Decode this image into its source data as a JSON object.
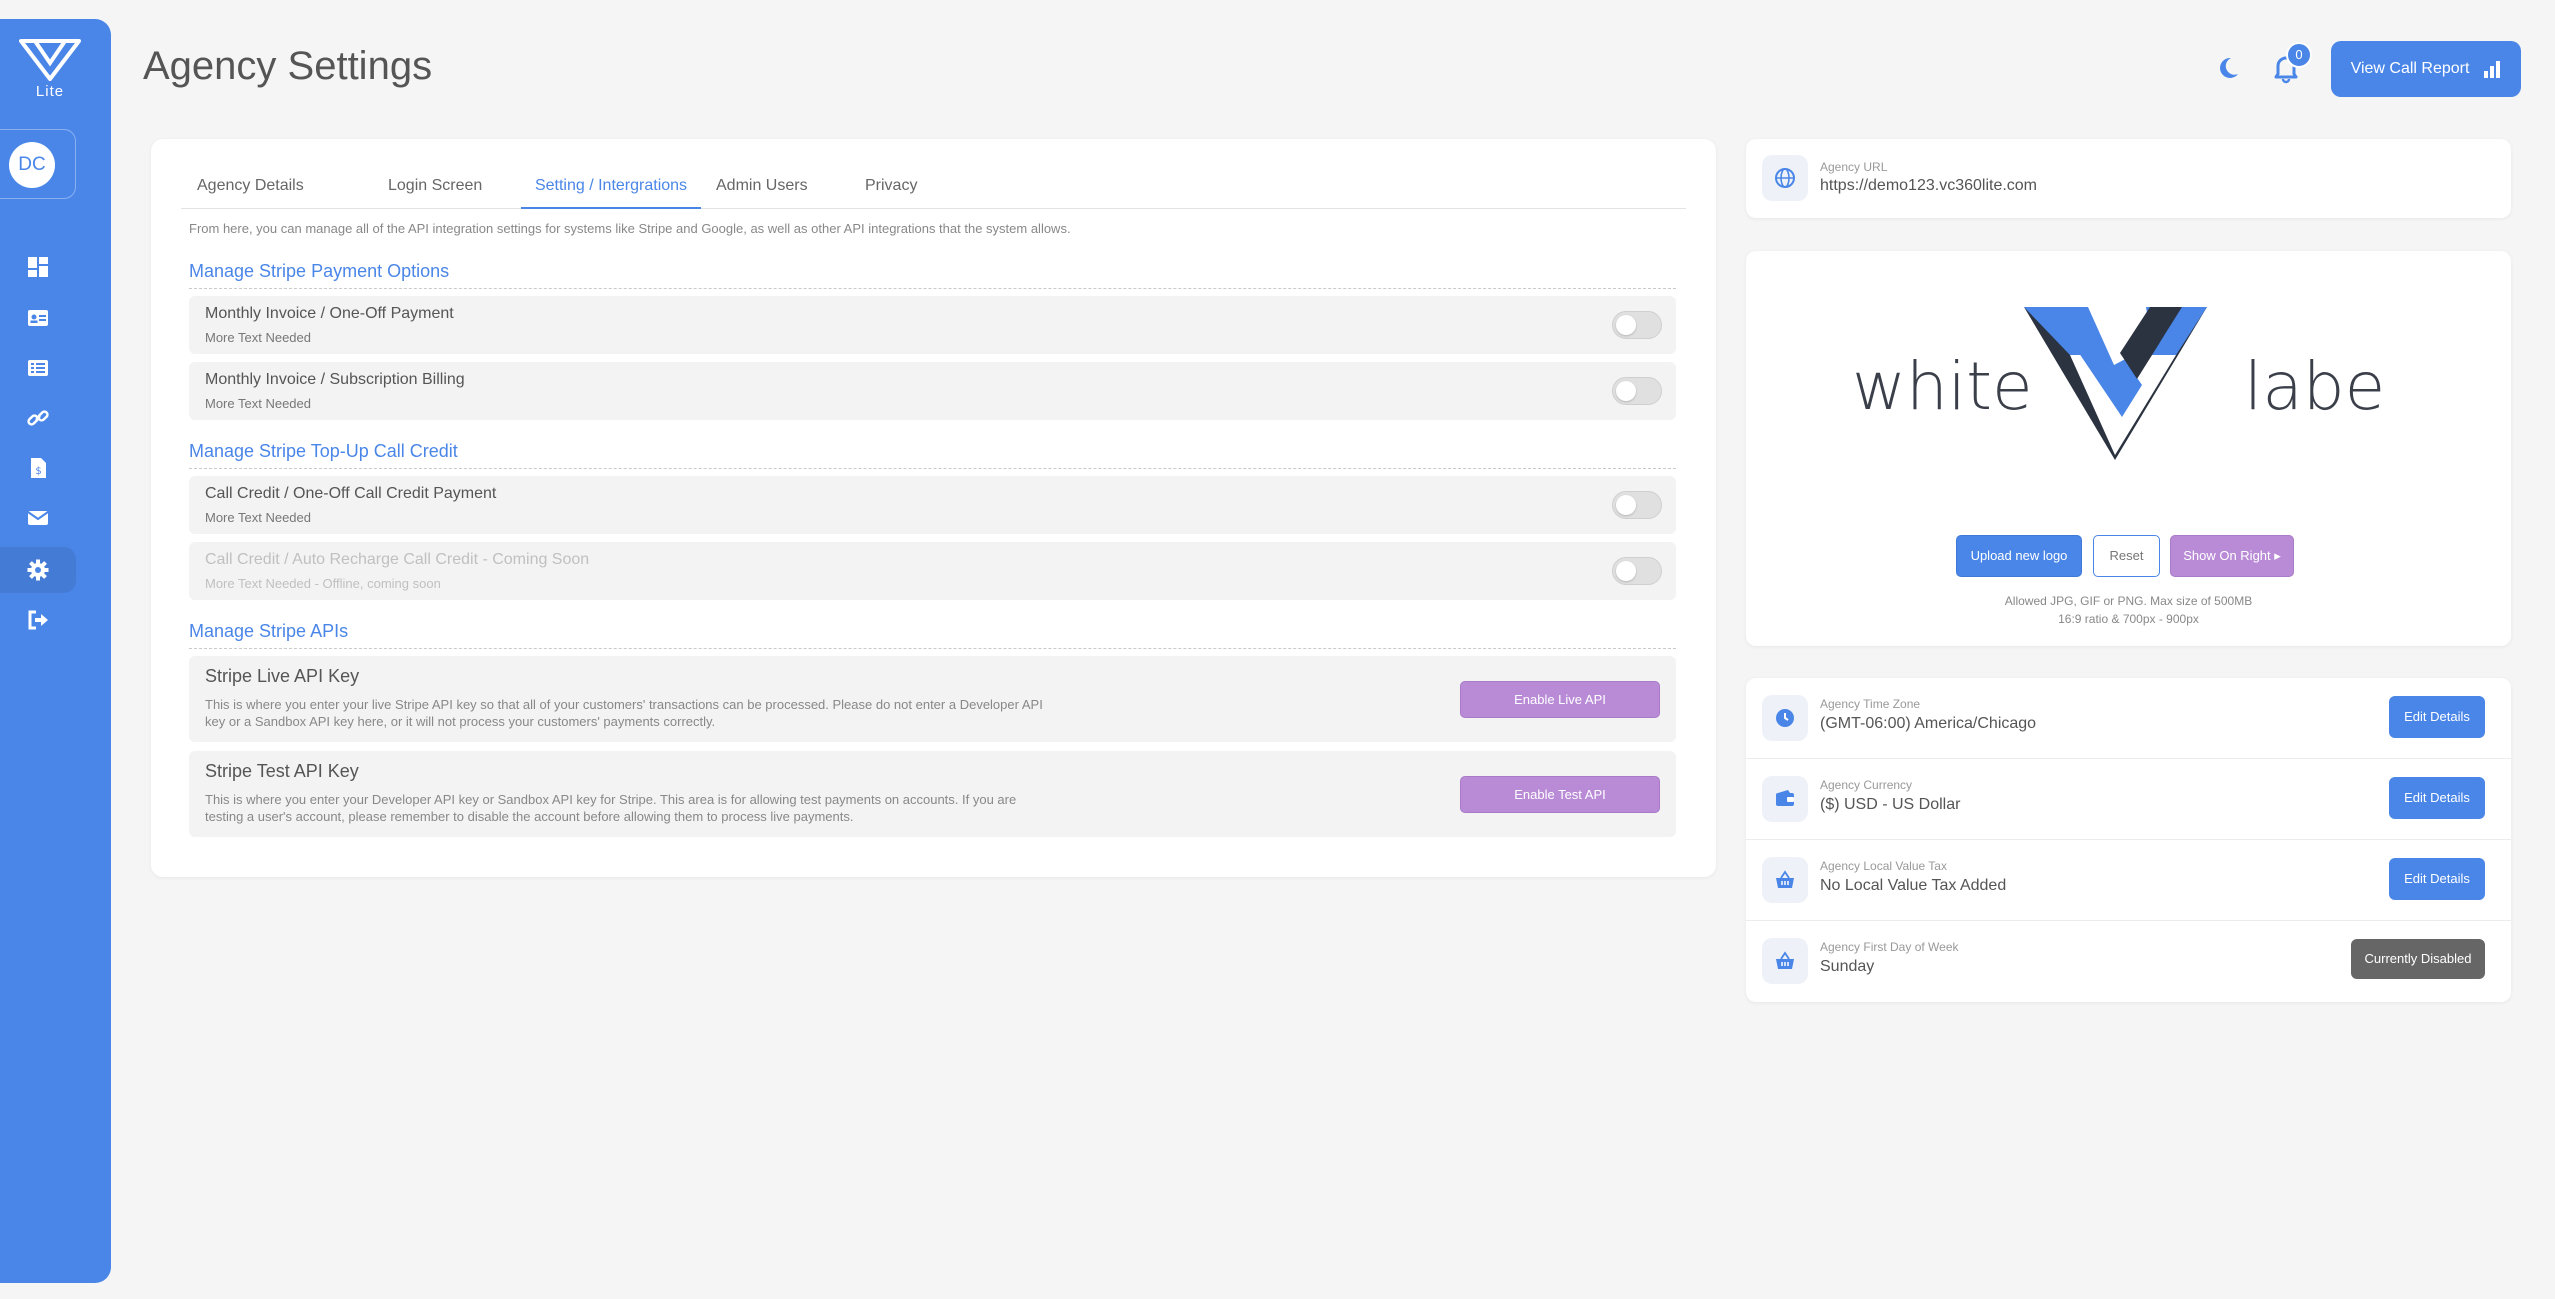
{
  "sidebar": {
    "logo_text": "Lite",
    "avatar_initials": "DC",
    "nav": [
      {
        "icon": "dashboard-icon"
      },
      {
        "icon": "contact-card-icon"
      },
      {
        "icon": "list-icon"
      },
      {
        "icon": "link-icon"
      },
      {
        "icon": "invoice-icon"
      },
      {
        "icon": "mail-icon"
      },
      {
        "icon": "gear-icon"
      },
      {
        "icon": "logout-icon"
      }
    ]
  },
  "header": {
    "title": "Agency Settings",
    "notification_count": "0",
    "report_button": "View Call Report"
  },
  "tabs": [
    "Agency Details",
    "Login Screen",
    "Setting / Intergrations",
    "Admin Users",
    "Privacy"
  ],
  "intro": "From here, you can manage all of the API integration settings for systems like Stripe and Google, as well as other API integrations that the system allows.",
  "sections": {
    "payment": {
      "title": "Manage Stripe Payment Options",
      "options": [
        {
          "title": "Monthly Invoice / One-Off Payment",
          "sub": "More Text Needed"
        },
        {
          "title": "Monthly Invoice / Subscription Billing",
          "sub": "More Text Needed"
        }
      ]
    },
    "topup": {
      "title": "Manage Stripe Top-Up Call Credit",
      "options": [
        {
          "title": "Call Credit / One-Off Call Credit Payment",
          "sub": "More Text Needed"
        },
        {
          "title": "Call Credit / Auto Recharge Call Credit - Coming Soon",
          "sub": "More Text Needed - Offline, coming soon"
        }
      ]
    },
    "apis": {
      "title": "Manage Stripe APIs",
      "items": [
        {
          "title": "Stripe Live API Key",
          "desc": "This is where you enter your live Stripe API key so that all of your customers' transactions can be processed. Please do not enter a Developer API key or a Sandbox API key here, or it will not process your customers' payments correctly.",
          "button": "Enable Live API"
        },
        {
          "title": "Stripe Test API Key",
          "desc": "This is where you enter your Developer API key or Sandbox API key for Stripe. This area is for allowing test payments on accounts. If you are testing a user's account, please remember to disable the account before allowing them to process live payments.",
          "button": "Enable Test API"
        }
      ]
    }
  },
  "url_card": {
    "label": "Agency URL",
    "value": "https://demo123.vc360lite.com"
  },
  "logo_card": {
    "word_left": "white",
    "word_right": "label",
    "upload": "Upload new logo",
    "reset": "Reset",
    "show_right": "Show On Right",
    "hint1": "Allowed JPG, GIF or PNG. Max size of 500MB",
    "hint2": "16:9 ratio & 700px - 900px"
  },
  "settings": [
    {
      "label": "Agency Time Zone",
      "value": "(GMT-06:00) America/Chicago",
      "button": "Edit Details",
      "icon": "clock-icon"
    },
    {
      "label": "Agency Currency",
      "value": "($) USD - US Dollar",
      "button": "Edit Details",
      "icon": "wallet-icon"
    },
    {
      "label": "Agency Local Value Tax",
      "value": "No Local Value Tax Added",
      "button": "Edit Details",
      "icon": "basket-icon"
    },
    {
      "label": "Agency First Day of Week",
      "value": "Sunday",
      "button": "Currently Disabled",
      "icon": "basket-icon"
    }
  ],
  "colors": {
    "accent": "#4a86e8",
    "purple": "#b98bd6",
    "dark_gray": "#666666"
  }
}
